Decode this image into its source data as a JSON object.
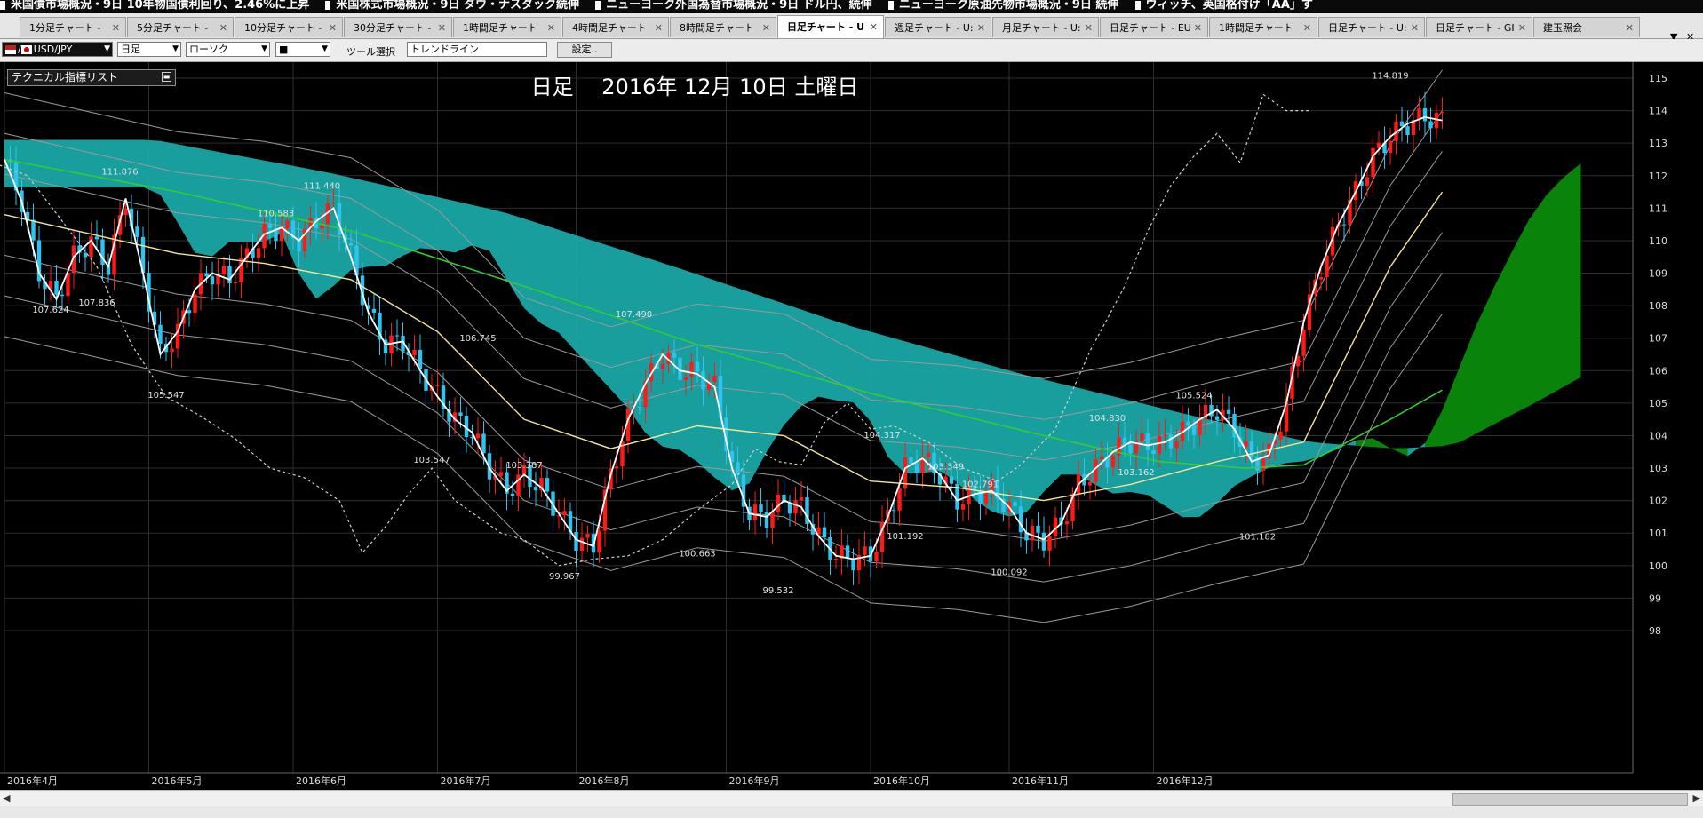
{
  "ticker": [
    "米国債市場概況・9日 10年物国債利回り、2.46%に上昇",
    "米国株式市場概況・9日 ダウ・ナスダック続伸",
    "ニューヨーク外国為替市場概況・9日 ドル円、続伸",
    "ニューヨーク原油先物市場概況・9日 続伸",
    "ウィッチ、英国格付け「AA」す"
  ],
  "tabs": [
    {
      "label": "1分足チャート -"
    },
    {
      "label": "5分足チャート -"
    },
    {
      "label": "10分足チャート -"
    },
    {
      "label": "30分足チャート -"
    },
    {
      "label": "1時間足チャート"
    },
    {
      "label": "4時間足チャート"
    },
    {
      "label": "8時間足チャート"
    },
    {
      "label": "日足チャート - U",
      "active": true
    },
    {
      "label": "週足チャート - U:"
    },
    {
      "label": "月足チャート - U:"
    },
    {
      "label": "日足チャート - EU"
    },
    {
      "label": "1時間足チャート"
    },
    {
      "label": "日足チャート - U:"
    },
    {
      "label": "日足チャート - GI"
    },
    {
      "label": "建玉照会"
    }
  ],
  "toolbar": {
    "symbol": "USD/JPY",
    "period": "日足",
    "chart_type": "ローソク",
    "line_style": "■",
    "tool_label": "ツール選択",
    "tool_value": "トレンドライン",
    "settings_button": "設定.."
  },
  "indicator_panel": {
    "title": "テクニカル指標リスト"
  },
  "colors": {
    "background": "#000000",
    "candle_up": "#ff1a1a",
    "candle_down": "#2ec4ef",
    "cloud_teal": "#1aa7a7",
    "cloud_green": "#0a8a0a",
    "sma_white": "#ffffff",
    "ma_yellow": "#f3e59a",
    "ma_green": "#33cc33",
    "bands_gray": "#9a9a9a"
  },
  "chart_data": {
    "type": "line",
    "title": "日足　 2016年 12月 10日 土曜日",
    "y_axis": {
      "min": 98,
      "max": 115,
      "ticks": [
        115,
        114,
        113,
        112,
        111,
        110,
        109,
        108,
        107,
        106,
        105,
        104,
        103,
        102,
        101,
        100,
        99,
        98
      ]
    },
    "x_axis_labels": [
      "2016年4月",
      "2016年5月",
      "2016年6月",
      "2016年7月",
      "2016年8月",
      "2016年9月",
      "2016年10月",
      "2016年11月",
      "2016年12月"
    ],
    "grid": true,
    "series": [
      {
        "points": [
          [
            0,
            112.5
          ],
          [
            3,
            111.2
          ],
          [
            6,
            109.0
          ],
          [
            9,
            108.2
          ],
          [
            12,
            109.5
          ],
          [
            15,
            110.0
          ],
          [
            18,
            109.2
          ],
          [
            21,
            111.3
          ],
          [
            24,
            109.0
          ],
          [
            27,
            106.5
          ],
          [
            30,
            107.2
          ],
          [
            33,
            108.5
          ],
          [
            36,
            109.0
          ],
          [
            39,
            108.8
          ],
          [
            42,
            109.5
          ],
          [
            45,
            110.2
          ],
          [
            48,
            110.4
          ],
          [
            51,
            110.0
          ],
          [
            54,
            110.6
          ],
          [
            57,
            111.0
          ],
          [
            60,
            109.5
          ],
          [
            63,
            107.8
          ],
          [
            66,
            106.8
          ],
          [
            69,
            106.9
          ],
          [
            72,
            106.0
          ],
          [
            75,
            105.2
          ],
          [
            78,
            104.5
          ],
          [
            81,
            104.1
          ],
          [
            84,
            103.0
          ],
          [
            87,
            102.3
          ],
          [
            90,
            102.8
          ],
          [
            93,
            102.4
          ],
          [
            96,
            101.6
          ],
          [
            99,
            100.8
          ],
          [
            102,
            100.6
          ],
          [
            105,
            102.8
          ],
          [
            108,
            104.5
          ],
          [
            111,
            105.6
          ],
          [
            114,
            106.5
          ],
          [
            117,
            106.0
          ],
          [
            120,
            105.9
          ],
          [
            123,
            105.5
          ],
          [
            126,
            103.0
          ],
          [
            129,
            101.6
          ],
          [
            132,
            101.5
          ],
          [
            135,
            102.0
          ],
          [
            138,
            101.8
          ],
          [
            141,
            100.9
          ],
          [
            144,
            100.3
          ],
          [
            147,
            100.2
          ],
          [
            150,
            100.3
          ],
          [
            153,
            101.5
          ],
          [
            156,
            103.0
          ],
          [
            159,
            103.3
          ],
          [
            162,
            102.8
          ],
          [
            165,
            102.0
          ],
          [
            168,
            102.2
          ],
          [
            171,
            102.3
          ],
          [
            174,
            101.8
          ],
          [
            177,
            101.0
          ],
          [
            180,
            100.8
          ],
          [
            183,
            101.3
          ],
          [
            186,
            102.5
          ],
          [
            189,
            103.0
          ],
          [
            192,
            103.5
          ],
          [
            195,
            103.8
          ],
          [
            198,
            103.7
          ],
          [
            201,
            103.8
          ],
          [
            204,
            104.1
          ],
          [
            207,
            104.5
          ],
          [
            210,
            104.8
          ],
          [
            213,
            104.2
          ],
          [
            216,
            103.2
          ],
          [
            219,
            103.4
          ],
          [
            222,
            105.0
          ],
          [
            225,
            107.5
          ],
          [
            228,
            109.2
          ],
          [
            231,
            110.5
          ],
          [
            234,
            111.5
          ],
          [
            237,
            112.6
          ],
          [
            240,
            113.2
          ],
          [
            243,
            113.6
          ],
          [
            246,
            113.8
          ],
          [
            249,
            113.7
          ]
        ]
      },
      {
        "points": [
          [
            0,
            110.8
          ],
          [
            15,
            110.2
          ],
          [
            30,
            109.6
          ],
          [
            45,
            109.3
          ],
          [
            60,
            108.8
          ],
          [
            75,
            107.2
          ],
          [
            90,
            104.5
          ],
          [
            105,
            103.6
          ],
          [
            120,
            104.3
          ],
          [
            135,
            104.0
          ],
          [
            150,
            102.6
          ],
          [
            165,
            102.4
          ],
          [
            180,
            102.0
          ],
          [
            195,
            102.5
          ],
          [
            210,
            103.2
          ],
          [
            225,
            103.8
          ],
          [
            240,
            109.2
          ],
          [
            249,
            111.5
          ]
        ]
      },
      {
        "points": [
          [
            0,
            112.5
          ],
          [
            30,
            111.5
          ],
          [
            60,
            110.3
          ],
          [
            90,
            108.6
          ],
          [
            120,
            106.8
          ],
          [
            150,
            105.3
          ],
          [
            180,
            104.0
          ],
          [
            200,
            103.2
          ],
          [
            215,
            103.0
          ],
          [
            225,
            103.1
          ],
          [
            240,
            104.5
          ],
          [
            249,
            105.4
          ]
        ]
      },
      {
        "points": [
          [
            -26,
            107.0
          ],
          [
            -20,
            108.5
          ],
          [
            -14,
            110.3
          ],
          [
            -8,
            111.8
          ],
          [
            -2,
            112.4
          ],
          [
            4,
            112.0
          ],
          [
            10,
            110.6
          ],
          [
            16,
            109.2
          ],
          [
            22,
            106.8
          ],
          [
            28,
            105.2
          ],
          [
            34,
            104.6
          ],
          [
            40,
            103.9
          ],
          [
            46,
            103.0
          ],
          [
            52,
            102.7
          ],
          [
            58,
            102.0
          ],
          [
            62,
            100.4
          ],
          [
            66,
            101.2
          ],
          [
            70,
            102.2
          ],
          [
            74,
            103.0
          ],
          [
            78,
            102.0
          ],
          [
            82,
            101.5
          ],
          [
            86,
            101.0
          ],
          [
            90,
            100.8
          ],
          [
            96,
            100.0
          ],
          [
            102,
            100.2
          ],
          [
            108,
            100.3
          ],
          [
            114,
            100.8
          ],
          [
            120,
            101.7
          ],
          [
            126,
            102.5
          ],
          [
            130,
            103.6
          ],
          [
            134,
            103.2
          ],
          [
            138,
            103.1
          ],
          [
            142,
            104.4
          ],
          [
            146,
            105.0
          ],
          [
            150,
            104.2
          ],
          [
            154,
            104.3
          ],
          [
            160,
            103.8
          ],
          [
            166,
            103.0
          ],
          [
            172,
            102.6
          ],
          [
            176,
            103.1
          ],
          [
            182,
            104.2
          ],
          [
            188,
            106.6
          ],
          [
            194,
            108.6
          ],
          [
            198,
            110.3
          ],
          [
            202,
            111.7
          ],
          [
            206,
            112.6
          ],
          [
            210,
            113.3
          ],
          [
            214,
            112.4
          ],
          [
            218,
            114.5
          ],
          [
            222,
            114.0
          ],
          [
            226,
            114.0
          ]
        ]
      }
    ],
    "annotations": [
      {
        "x": 20,
        "y": 111.876,
        "label": "111.876"
      },
      {
        "x": 55,
        "y": 111.44,
        "label": "111.440"
      },
      {
        "x": 47,
        "y": 110.583,
        "label": "110.583"
      },
      {
        "x": 8,
        "y": 107.624,
        "label": "107.624"
      },
      {
        "x": 16,
        "y": 107.836,
        "label": "107.836"
      },
      {
        "x": 28,
        "y": 105.547,
        "label": "105.547"
      },
      {
        "x": 82,
        "y": 106.745,
        "label": "106.745"
      },
      {
        "x": 109,
        "y": 107.49,
        "label": "107.490"
      },
      {
        "x": 74,
        "y": 103.547,
        "label": "103.547"
      },
      {
        "x": 90,
        "y": 103.387,
        "label": "103.387"
      },
      {
        "x": 97,
        "y": 99.967,
        "label": "99.967"
      },
      {
        "x": 120,
        "y": 100.663,
        "label": "100.663"
      },
      {
        "x": 134,
        "y": 99.532,
        "label": "99.532"
      },
      {
        "x": 152,
        "y": 104.317,
        "label": "104.317"
      },
      {
        "x": 163,
        "y": 103.349,
        "label": "103.349"
      },
      {
        "x": 156,
        "y": 101.192,
        "label": "101.192"
      },
      {
        "x": 169,
        "y": 102.791,
        "label": "102.791"
      },
      {
        "x": 174,
        "y": 100.092,
        "label": "100.092"
      },
      {
        "x": 191,
        "y": 104.83,
        "label": "104.830"
      },
      {
        "x": 196,
        "y": 103.162,
        "label": "103.162"
      },
      {
        "x": 206,
        "y": 105.524,
        "label": "105.524"
      },
      {
        "x": 217,
        "y": 101.182,
        "label": "101.182"
      },
      {
        "x": 240,
        "y": 114.819,
        "label": "114.819"
      }
    ]
  }
}
